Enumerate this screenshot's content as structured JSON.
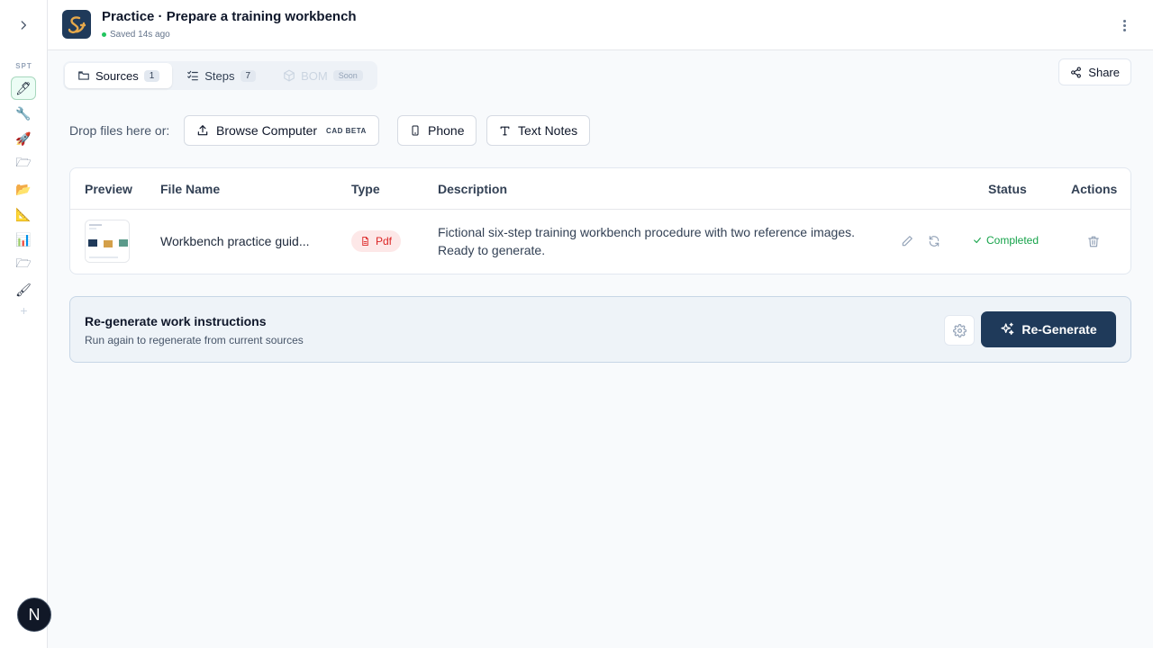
{
  "rail": {
    "tag": "SPT",
    "items": [
      {
        "icon": "pencil-icon",
        "glyph": "🖊"
      },
      {
        "icon": "wrench-icon",
        "glyph": "🔧"
      },
      {
        "icon": "rocket-icon",
        "glyph": "🚀"
      },
      {
        "icon": "folder-icon",
        "glyph": "🗁"
      },
      {
        "icon": "open-folder-icon",
        "glyph": "📂"
      },
      {
        "icon": "ruler-icon",
        "glyph": "📐"
      },
      {
        "icon": "chart-icon",
        "glyph": "📊"
      },
      {
        "icon": "folder-outline-icon",
        "glyph": "🗁"
      },
      {
        "icon": "brush-icon",
        "glyph": "🖌"
      }
    ],
    "add_label": "+",
    "user_initial": "N"
  },
  "header": {
    "title": "Practice · Prepare a training workbench",
    "saved": "Saved 14s ago"
  },
  "tabs": [
    {
      "label": "Sources",
      "count": "1"
    },
    {
      "label": "Steps",
      "count": "7"
    },
    {
      "label": "BOM",
      "badge": "Soon"
    }
  ],
  "share_label": "Share",
  "sources": {
    "drop_label": "Drop files here or:",
    "browse_label": "Browse Computer",
    "browse_badge": "CAD BETA",
    "phone_label": "Phone",
    "text_label": "Text Notes"
  },
  "table": {
    "headers": [
      "Preview",
      "File Name",
      "Type",
      "Description",
      "Status",
      "Actions"
    ],
    "rows": [
      {
        "file_name": "Workbench practice guid...",
        "type": "Pdf",
        "description": "Fictional six-step training workbench procedure with two reference images. Ready to generate.",
        "status": "Completed"
      }
    ]
  },
  "regenerate": {
    "title": "Re-generate work instructions",
    "subtitle": "Run again to regenerate from current sources",
    "button_label": "Re-Generate"
  },
  "colors": {
    "primary": "#1f3a5a",
    "success": "#16a34a",
    "pdf": "#dc2626"
  }
}
